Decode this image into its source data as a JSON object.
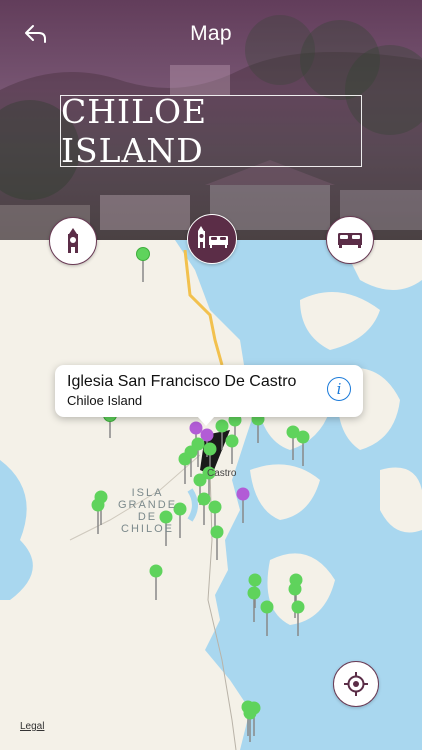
{
  "header": {
    "nav_title": "Map",
    "back_icon": "back-arrow-icon",
    "banner_title": "CHILOE ISLAND"
  },
  "categories": [
    {
      "name": "landmarks",
      "icon": "clock-tower-icon",
      "active": false
    },
    {
      "name": "landmarks-and-hotels",
      "icon": "church-and-bed-icon",
      "active": true
    },
    {
      "name": "hotels",
      "icon": "bed-icon",
      "active": false
    }
  ],
  "map": {
    "labels": {
      "island_line1": "ISLA",
      "island_line2": "GRANDE",
      "island_line3": "DE",
      "island_line4": "CHILOE",
      "town": "Castro"
    },
    "legal": "Legal",
    "pin_colors": {
      "green": "#5fd35c",
      "purple": "#b25cd6",
      "black": "#1a1a1a"
    }
  },
  "callout": {
    "title": "Iglesia San Francisco De Castro",
    "subtitle": "Chiloe Island",
    "info_icon": "info-icon"
  },
  "locate_button": {
    "icon": "crosshair-icon"
  },
  "colors": {
    "accent": "#5b2d47",
    "water": "#a9d7ef",
    "land": "#f4f1e8",
    "road": "#f2c14e",
    "info_blue": "#1a7ad9"
  }
}
